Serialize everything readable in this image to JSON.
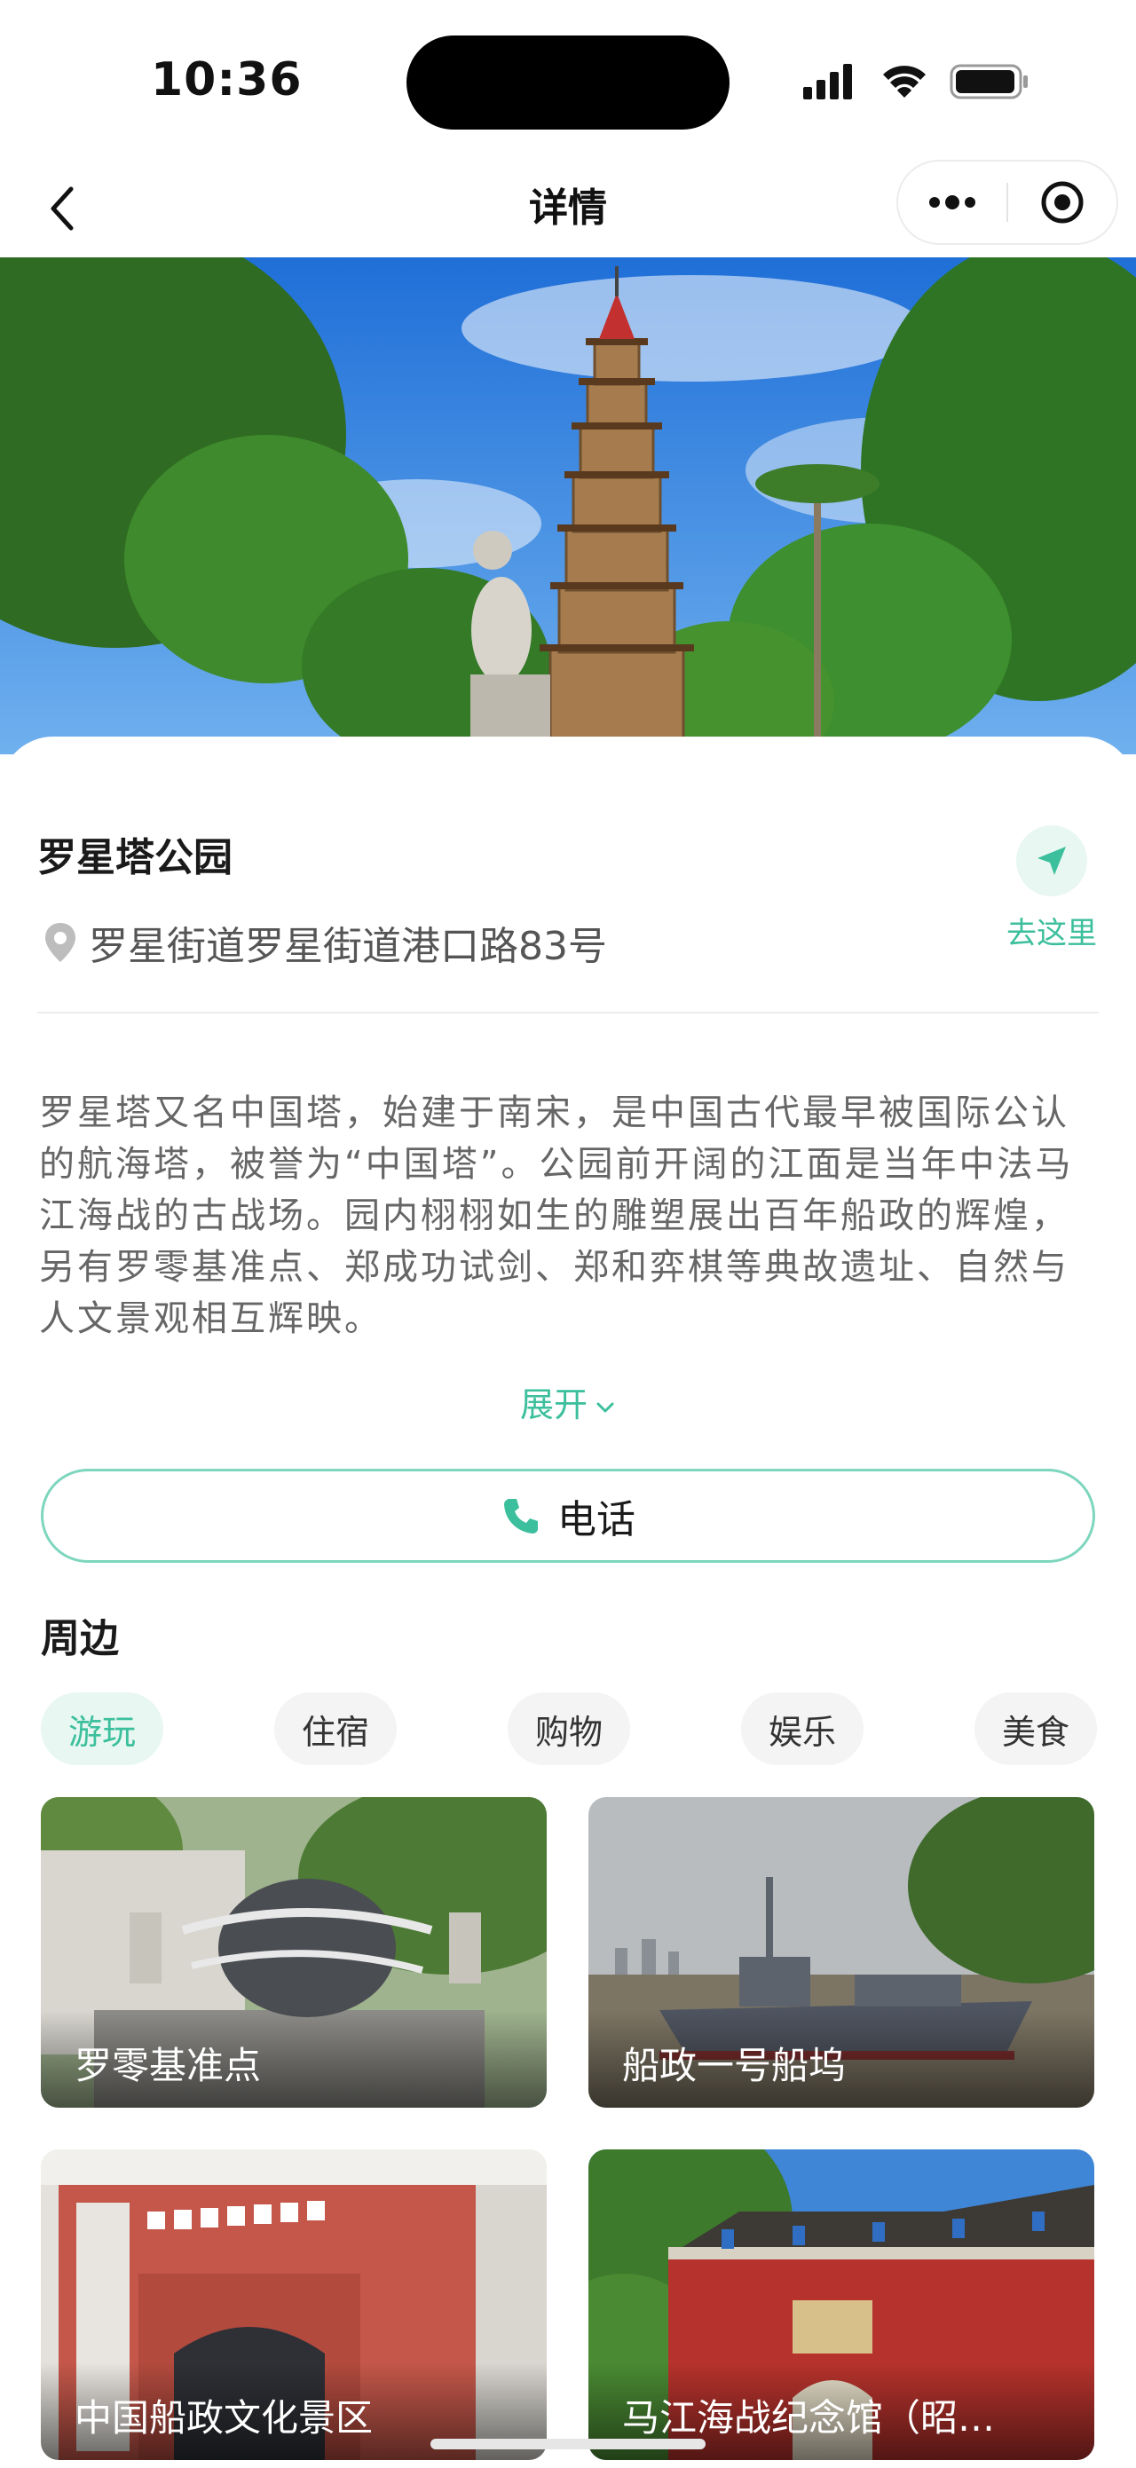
{
  "status_bar": {
    "time": "10:36"
  },
  "nav": {
    "title": "详情"
  },
  "place": {
    "name": "罗星塔公园",
    "address": "罗星街道罗星街道港口路83号",
    "go_label": "去这里",
    "description": "罗星塔又名中国塔，始建于南宋，是中国古代最早被国际公认的航海塔，被誉为“中国塔”。公园前开阔的江面是当年中法马江海战的古战场。园内栩栩如生的雕塑展出百年船政的辉煌，另有罗零基准点、郑成功试剑、郑和弈棋等典故遗址、自然与人文景观相互辉映。",
    "expand_label": "展开",
    "phone_label": "电话"
  },
  "nearby": {
    "title": "周边",
    "tabs": [
      {
        "label": "游玩",
        "active": true
      },
      {
        "label": "住宿",
        "active": false
      },
      {
        "label": "购物",
        "active": false
      },
      {
        "label": "娱乐",
        "active": false
      },
      {
        "label": "美食",
        "active": false
      }
    ],
    "items": [
      {
        "name": "罗零基准点"
      },
      {
        "name": "船政一号船坞"
      },
      {
        "name": "中国船政文化景区"
      },
      {
        "name": "马江海战纪念馆（昭…"
      }
    ]
  },
  "colors": {
    "accent": "#3cbf9c",
    "accent_light": "#e8f7f2",
    "text_secondary": "#666666"
  }
}
